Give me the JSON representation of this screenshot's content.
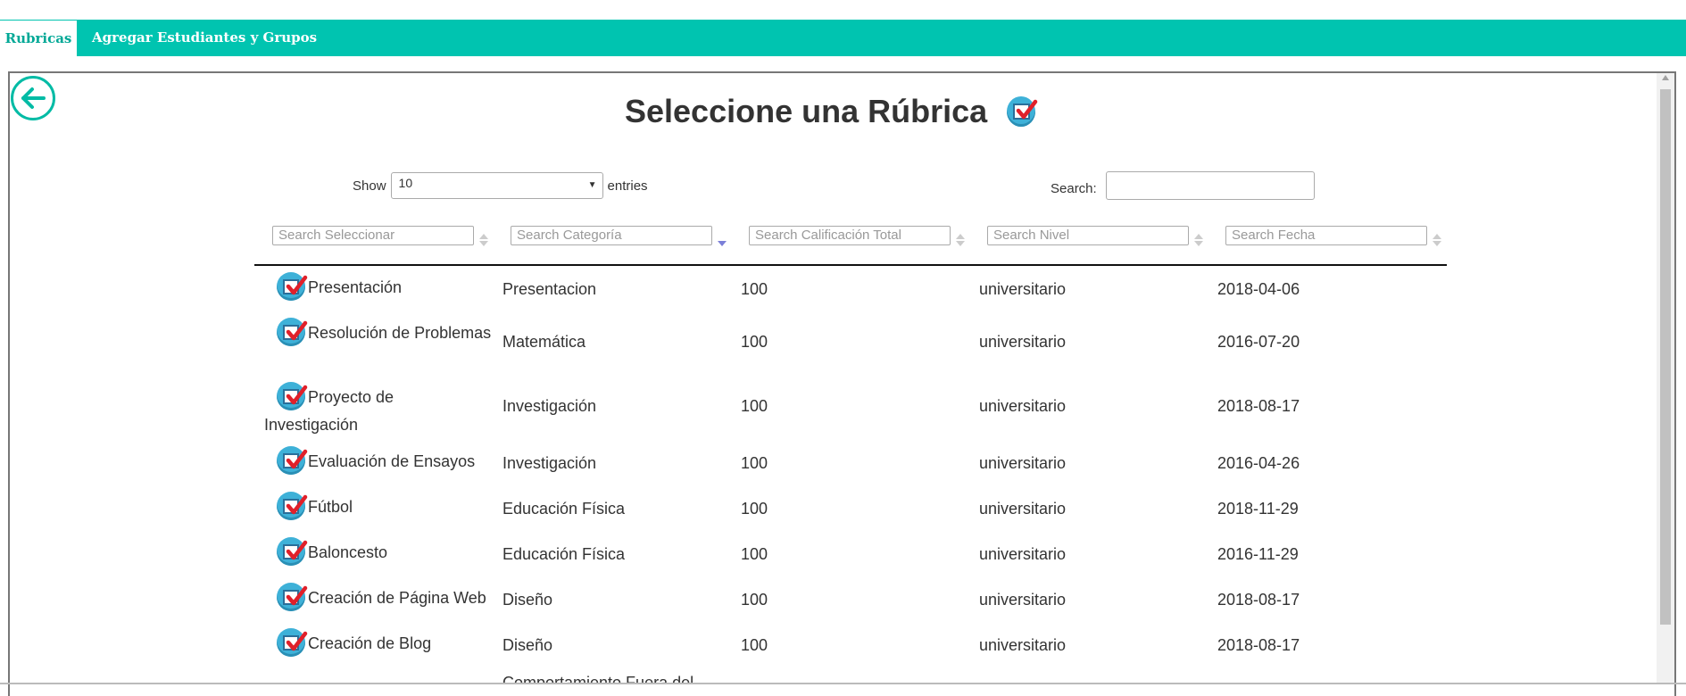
{
  "tabs": [
    {
      "label": "Rubricas",
      "active": true
    },
    {
      "label": "Agregar Estudiantes y Grupos",
      "active": false
    }
  ],
  "page_title": "Seleccione una Rúbrica",
  "icons": {
    "back": "arrow-left-circle-icon",
    "check": "checkbox-checked-icon"
  },
  "colors": {
    "accent": "#00c4b0",
    "checkbox": "#3eb1d8",
    "tick": "#e0202a"
  },
  "controls": {
    "show_label": "Show",
    "entries_value": "10",
    "entries_label": "entries",
    "search_label": "Search:",
    "search_value": ""
  },
  "column_filters": [
    "Search Seleccionar",
    "Search Categoría",
    "Search Calificación Total",
    "Search Nivel",
    "Search Fecha"
  ],
  "rows": [
    {
      "name": "Presentación",
      "category": "Presentacion",
      "total": "100",
      "level": "universitario",
      "date": "2018-04-06"
    },
    {
      "name": "Resolución de Problemas",
      "category": "Matemática",
      "total": "100",
      "level": "universitario",
      "date": "2016-07-20"
    },
    {
      "name": "Proyecto de Investigación",
      "category": "Investigación",
      "total": "100",
      "level": "universitario",
      "date": "2018-08-17"
    },
    {
      "name": "Evaluación de Ensayos",
      "category": "Investigación",
      "total": "100",
      "level": "universitario",
      "date": "2016-04-26"
    },
    {
      "name": "Fútbol",
      "category": "Educación Física",
      "total": "100",
      "level": "universitario",
      "date": "2018-11-29"
    },
    {
      "name": "Baloncesto",
      "category": "Educación Física",
      "total": "100",
      "level": "universitario",
      "date": "2016-11-29"
    },
    {
      "name": "Creación de Página Web",
      "category": "Diseño",
      "total": "100",
      "level": "universitario",
      "date": "2018-08-17"
    },
    {
      "name": "Creación de Blog",
      "category": "Diseño",
      "total": "100",
      "level": "universitario",
      "date": "2018-08-17"
    },
    {
      "name": "",
      "category": "Comportamiento Fuera del",
      "total": "",
      "level": "",
      "date": ""
    }
  ]
}
